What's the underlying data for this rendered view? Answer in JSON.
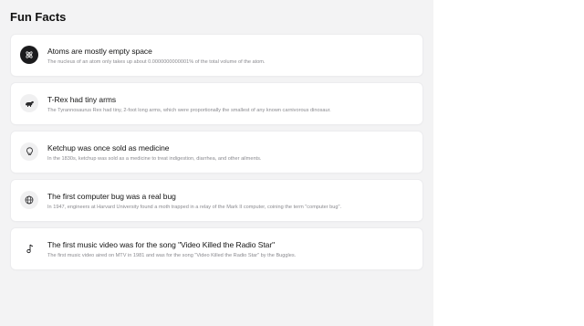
{
  "page": {
    "title": "Fun Facts"
  },
  "facts": [
    {
      "icon": "atom-icon",
      "title": "Atoms are mostly empty space",
      "description": "The nucleus of an atom only takes up about 0.0000000000001% of the total volume of the atom."
    },
    {
      "icon": "dinosaur-icon",
      "title": "T-Rex had tiny arms",
      "description": "The Tyrannosaurus Rex had tiny, 2-foot long arms, which were proportionally the smallest of any known carnivorous dinosaur."
    },
    {
      "icon": "lightbulb-icon",
      "title": "Ketchup was once sold as medicine",
      "description": "In the 1830s, ketchup was sold as a medicine to treat indigestion, diarrhea, and other ailments."
    },
    {
      "icon": "globe-icon",
      "title": "The first computer bug was a real bug",
      "description": "In 1947, engineers at Harvard University found a moth trapped in a relay of the Mark II computer, coining the term \"computer bug\"."
    },
    {
      "icon": "music-note-icon",
      "title": "The first music video was for the song \"Video Killed the Radio Star\"",
      "description": "The first music video aired on MTV in 1981 and was for the song \"Video Killed the Radio Star\" by the Buggles."
    }
  ]
}
